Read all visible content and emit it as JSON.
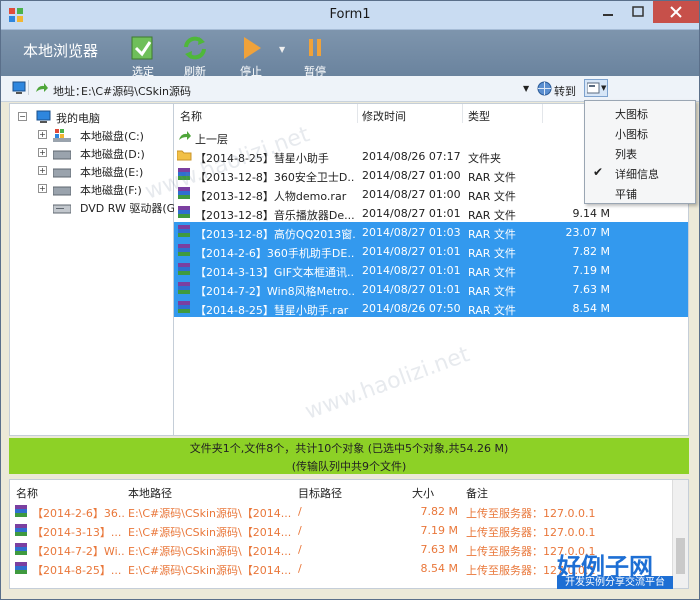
{
  "window": {
    "title": "Form1"
  },
  "header": {
    "app_name": "本地浏览器",
    "tools": [
      {
        "label": "选定",
        "icon": "select-icon"
      },
      {
        "label": "刷新",
        "icon": "refresh-icon"
      },
      {
        "label": "停止",
        "icon": "stop-icon"
      },
      {
        "label": "暂停",
        "icon": "pause-icon"
      }
    ]
  },
  "address": {
    "label": "地址：",
    "value": "E:\\C#源码\\CSkin源码",
    "go_label": "转到"
  },
  "tree": {
    "root": "我的电脑",
    "items": [
      "本地磁盘(C:)",
      "本地磁盘(D:)",
      "本地磁盘(E:)",
      "本地磁盘(F:)",
      "DVD RW 驱动器(G"
    ]
  },
  "list": {
    "columns": {
      "name": "名称",
      "time": "修改时间",
      "type": "类型"
    },
    "up": "上一层",
    "rows": [
      {
        "name": "【2014-8-25】彗星小助手",
        "time": "2014/08/26 07:17",
        "type": "文件夹",
        "size": "",
        "selected": false,
        "kind": "folder"
      },
      {
        "name": "【2013-12-8】360安全卫士D...",
        "time": "2014/08/27 01:00",
        "type": "RAR 文件",
        "size": "7.",
        "selected": false,
        "kind": "rar"
      },
      {
        "name": "【2013-12-8】人物demo.rar",
        "time": "2014/08/27 01:00",
        "type": "RAR 文件",
        "size": "8.",
        "selected": false,
        "kind": "rar"
      },
      {
        "name": "【2013-12-8】音乐播放器De...",
        "time": "2014/08/27 01:01",
        "type": "RAR 文件",
        "size": "9.14 M",
        "selected": false,
        "kind": "rar"
      },
      {
        "name": "【2013-12-8】高仿QQ2013窗...",
        "time": "2014/08/27 01:03",
        "type": "RAR 文件",
        "size": "23.07 M",
        "selected": true,
        "kind": "rar"
      },
      {
        "name": "【2014-2-6】360手机助手DE...",
        "time": "2014/08/27 01:01",
        "type": "RAR 文件",
        "size": "7.82 M",
        "selected": true,
        "kind": "rar"
      },
      {
        "name": "【2014-3-13】GIF文本框通讯...",
        "time": "2014/08/27 01:01",
        "type": "RAR 文件",
        "size": "7.19 M",
        "selected": true,
        "kind": "rar"
      },
      {
        "name": "【2014-7-2】Win8风格Metro...",
        "time": "2014/08/27 01:01",
        "type": "RAR 文件",
        "size": "7.63 M",
        "selected": true,
        "kind": "rar"
      },
      {
        "name": "【2014-8-25】彗星小助手.rar",
        "time": "2014/08/26 07:50",
        "type": "RAR 文件",
        "size": "8.54 M",
        "selected": true,
        "kind": "rar"
      }
    ]
  },
  "view_menu": {
    "items": [
      {
        "label": "大图标",
        "checked": false
      },
      {
        "label": "小图标",
        "checked": false
      },
      {
        "label": "列表",
        "checked": false
      },
      {
        "label": "详细信息",
        "checked": true
      },
      {
        "label": "平铺",
        "checked": false
      }
    ]
  },
  "status": {
    "summary": "文件夹1个,文件8个，共计10个对象 (已选中5个对象,共54.26 M)",
    "queue": "(传输队列中共9个文件)"
  },
  "queue": {
    "columns": {
      "name": "名称",
      "src": "本地路径",
      "dst": "目标路径",
      "size": "大小",
      "note": "备注"
    },
    "rows": [
      {
        "name": "【2014-2-6】36...",
        "src": "E:\\C#源码\\CSkin源码\\【2014...",
        "dst": "/",
        "size": "7.82 M",
        "note": "上传至服务器：127.0.0.1"
      },
      {
        "name": "【2014-3-13】...",
        "src": "E:\\C#源码\\CSkin源码\\【2014...",
        "dst": "/",
        "size": "7.19 M",
        "note": "上传至服务器：127.0.0.1"
      },
      {
        "name": "【2014-7-2】Wi...",
        "src": "E:\\C#源码\\CSkin源码\\【2014...",
        "dst": "/",
        "size": "7.63 M",
        "note": "上传至服务器：127.0.0.1"
      },
      {
        "name": "【2014-8-25】...",
        "src": "E:\\C#源码\\CSkin源码\\【2014...",
        "dst": "/",
        "size": "8.54 M",
        "note": "上传至服务器：127.0.0.1"
      }
    ]
  },
  "watermark": {
    "text": "www.haolizi.net",
    "badge_title": "好例子网",
    "badge_sub": "开发实例分享交流平台"
  },
  "colors": {
    "selection": "#3399ee",
    "status_bar": "#8dd126",
    "queue_text": "#e9773a",
    "header": "#7e95ad"
  }
}
